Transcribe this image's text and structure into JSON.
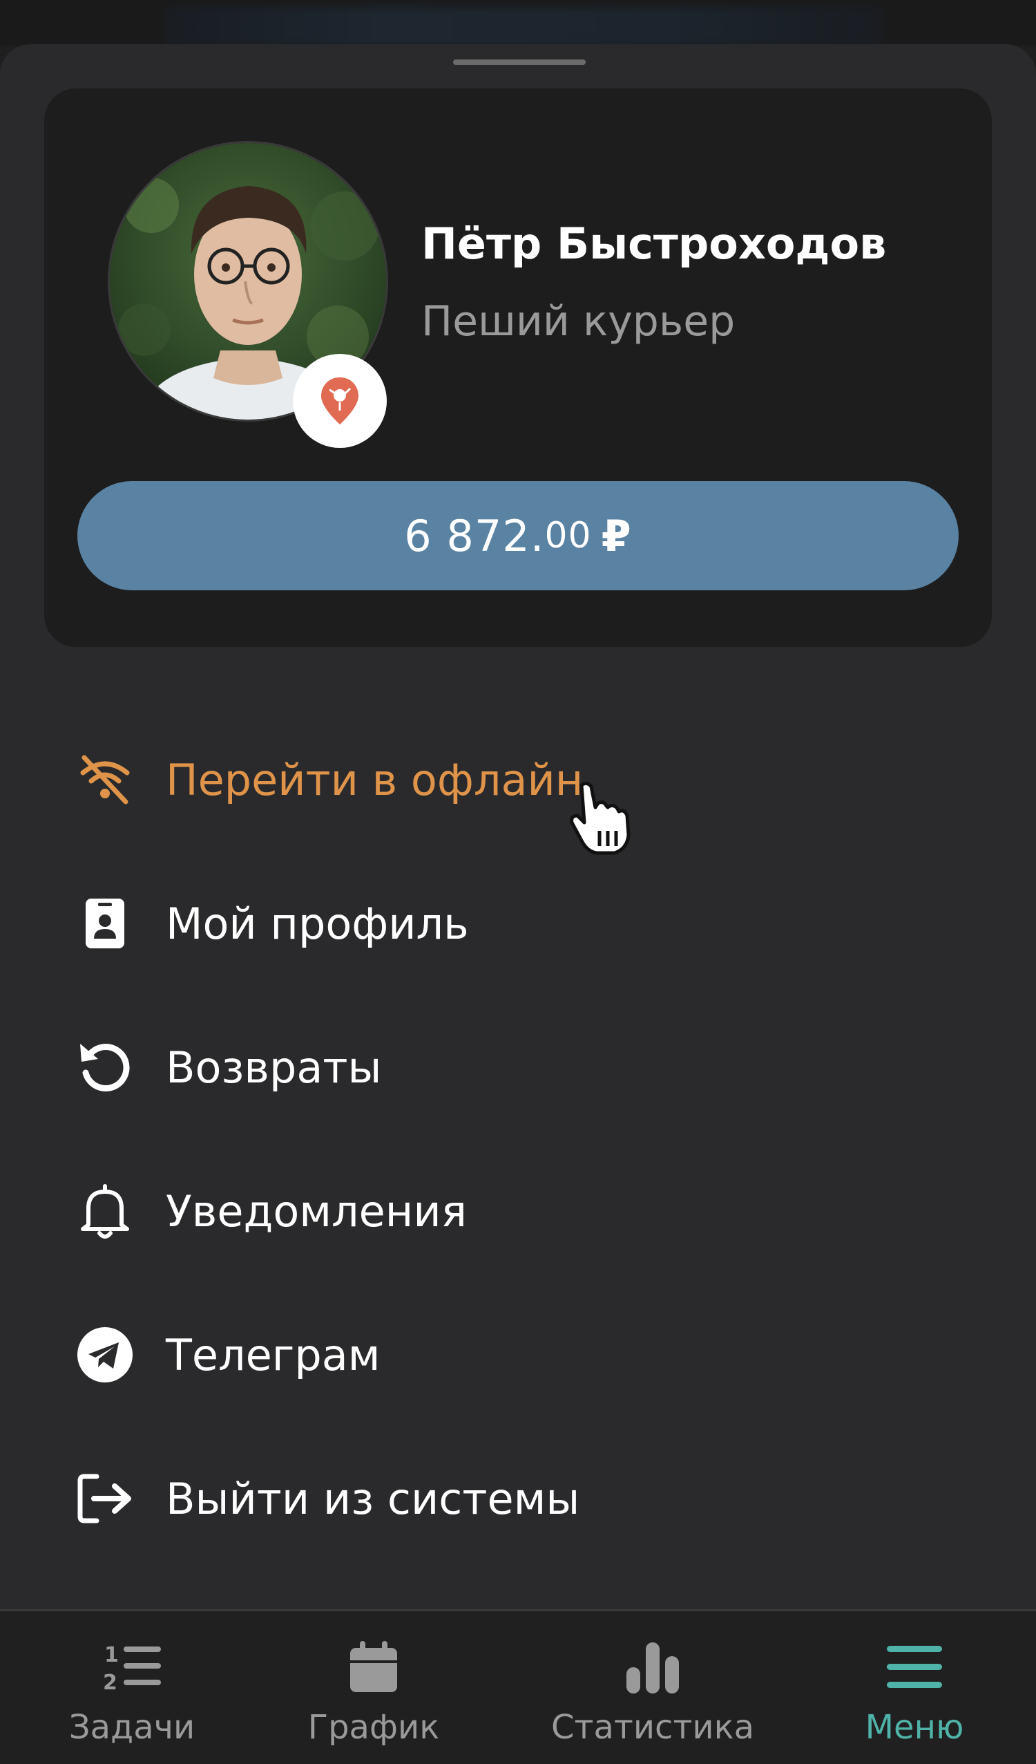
{
  "colors": {
    "sheet_bg": "#2a2a2c",
    "card_bg": "#1d1d1d",
    "balance_bg": "#5a82a3",
    "offline_accent": "#e0944a",
    "active_tab": "#4fb3a9",
    "inactive_tab": "#9a9a9a"
  },
  "profile": {
    "name": "Пётр Быстроходов",
    "role": "Пеший курьер",
    "avatar_icon": "user-photo",
    "badge_icon": "map-pin-icon"
  },
  "balance": {
    "integer": "6 872.",
    "cents": "00",
    "currency": "₽"
  },
  "menu": {
    "items": [
      {
        "label": "Перейти в офлайн",
        "icon": "wifi-off-icon"
      },
      {
        "label": "Мой профиль",
        "icon": "id-badge-icon"
      },
      {
        "label": "Возвраты",
        "icon": "undo-icon"
      },
      {
        "label": "Уведомления",
        "icon": "bell-icon"
      },
      {
        "label": "Телеграм",
        "icon": "telegram-icon"
      },
      {
        "label": "Выйти из системы",
        "icon": "logout-icon"
      }
    ]
  },
  "tabbar": {
    "tabs": [
      {
        "label": "Задачи",
        "icon": "ordered-list-icon",
        "active": false
      },
      {
        "label": "График",
        "icon": "calendar-icon",
        "active": false
      },
      {
        "label": "Статистика",
        "icon": "bar-chart-icon",
        "active": false
      },
      {
        "label": "Меню",
        "icon": "hamburger-menu-icon",
        "active": true
      }
    ]
  }
}
